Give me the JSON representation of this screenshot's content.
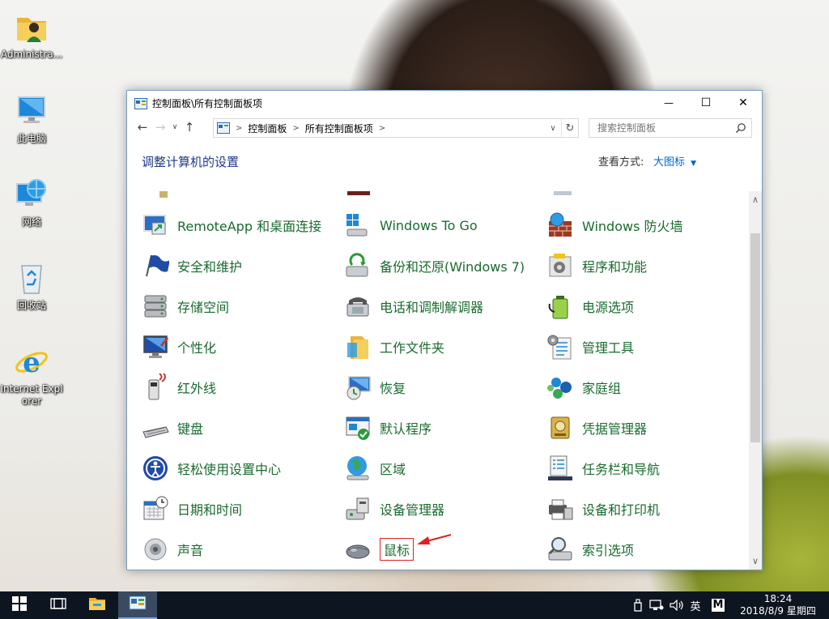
{
  "desktop": {
    "icons": [
      {
        "label": "Administra..."
      },
      {
        "label": "此电脑"
      },
      {
        "label": "网络"
      },
      {
        "label": "回收站"
      },
      {
        "label": "Internet Explorer"
      }
    ]
  },
  "window": {
    "title": "控制面板\\所有控制面板项",
    "controls": {
      "minimize": "—",
      "maximize": "☐",
      "close": "✕"
    },
    "address": {
      "crumbs": [
        "控制面板",
        "所有控制面板项"
      ]
    },
    "search": {
      "placeholder": "搜索控制面板"
    },
    "header": {
      "title": "调整计算机的设置",
      "view_by_label": "查看方式:",
      "view_by_value": "大图标"
    },
    "items": [
      {
        "label": "RemoteApp 和桌面连接",
        "icon": "remoteapp-icon"
      },
      {
        "label": "Windows To Go",
        "icon": "usb-drive-icon"
      },
      {
        "label": "Windows 防火墙",
        "icon": "firewall-icon"
      },
      {
        "label": "安全和维护",
        "icon": "flag-icon"
      },
      {
        "label": "备份和还原(Windows 7)",
        "icon": "backup-icon"
      },
      {
        "label": "程序和功能",
        "icon": "programs-icon"
      },
      {
        "label": "存储空间",
        "icon": "storage-icon"
      },
      {
        "label": "电话和调制解调器",
        "icon": "phone-icon"
      },
      {
        "label": "电源选项",
        "icon": "battery-icon"
      },
      {
        "label": "个性化",
        "icon": "monitor-icon"
      },
      {
        "label": "工作文件夹",
        "icon": "folder-icon"
      },
      {
        "label": "管理工具",
        "icon": "tools-icon"
      },
      {
        "label": "红外线",
        "icon": "infrared-icon"
      },
      {
        "label": "恢复",
        "icon": "recovery-icon"
      },
      {
        "label": "家庭组",
        "icon": "homegroup-icon"
      },
      {
        "label": "键盘",
        "icon": "keyboard-icon"
      },
      {
        "label": "默认程序",
        "icon": "default-programs-icon"
      },
      {
        "label": "凭据管理器",
        "icon": "credential-icon"
      },
      {
        "label": "轻松使用设置中心",
        "icon": "accessibility-icon"
      },
      {
        "label": "区域",
        "icon": "globe-icon"
      },
      {
        "label": "任务栏和导航",
        "icon": "taskbar-icon"
      },
      {
        "label": "日期和时间",
        "icon": "calendar-icon"
      },
      {
        "label": "设备管理器",
        "icon": "device-manager-icon"
      },
      {
        "label": "设备和打印机",
        "icon": "printer-icon"
      },
      {
        "label": "声音",
        "icon": "speaker-icon"
      },
      {
        "label": "鼠标",
        "icon": "mouse-icon"
      },
      {
        "label": "索引选项",
        "icon": "search-index-icon"
      }
    ]
  },
  "taskbar": {
    "tray": {
      "ime": "英",
      "m": "M"
    },
    "clock": {
      "time": "18:24",
      "date": "2018/8/9 星期四"
    }
  },
  "colors": {
    "item_text": "#1a6b2f",
    "header_title": "#1e3a8a",
    "link_blue": "#0066cc",
    "taskbar": "#0d1520",
    "highlight_border": "#e02020"
  }
}
